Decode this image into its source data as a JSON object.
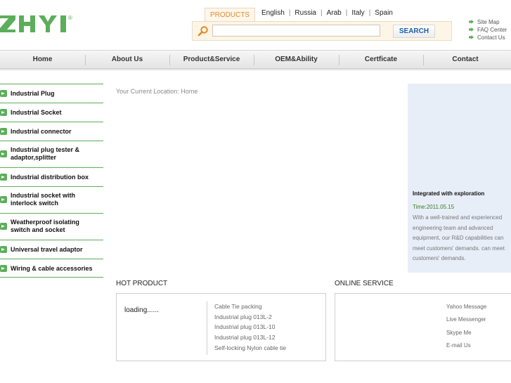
{
  "header": {
    "logo_text": "ZHYI",
    "registered_mark": "®",
    "products_tab": "PRODUCTS",
    "search_placeholder": "",
    "search_button": "SEARCH",
    "languages": [
      "English",
      "Russia",
      "Arab",
      "Italy",
      "Spain"
    ],
    "quick_links": [
      "Site Map",
      "FAQ Center",
      "Contact Us"
    ]
  },
  "nav": {
    "items": [
      "Home",
      "About Us",
      "Product&Service",
      "OEM&Ability",
      "Certficate",
      "Contact"
    ]
  },
  "sidebar": {
    "items": [
      "Industrial Plug",
      "Industrial Socket",
      "Industrial connector",
      "Industrial plug tester & adaptor,splitter",
      "Industrial distribution box",
      "Industrial socket with interlock switch",
      "Weatherproof isolating switch and socket",
      "Universal travel adaptor",
      "Wiring & cable accessories"
    ]
  },
  "main": {
    "location": "Your Current Location: Home"
  },
  "news": {
    "title": "Integrated with exploration",
    "time": "Time:2011.05.15",
    "body": "With a well-trained and experienced engineering team and advanced equipment, our R&D capabilities can meet customers' demands. can meet customers' demands."
  },
  "hot_product": {
    "title": "HOT PRODUCT",
    "loading": "loading......",
    "items": [
      "Cable Tie packing",
      "Industrial plug 013L-2",
      "Industrial plug 013L-10",
      "Industrial plug 013L-12",
      "Self-locking Nylon cable tie"
    ]
  },
  "online_service": {
    "title": "ONLINE SERVICE",
    "items": [
      "Yahoo Message",
      "Live Messenger",
      "Skype Me",
      "E-mail Us"
    ]
  },
  "colors": {
    "brand_green": "#5cae5a",
    "accent_orange": "#e08a2e",
    "link_blue": "#1f5fa8",
    "news_bg": "#e8eef8"
  }
}
